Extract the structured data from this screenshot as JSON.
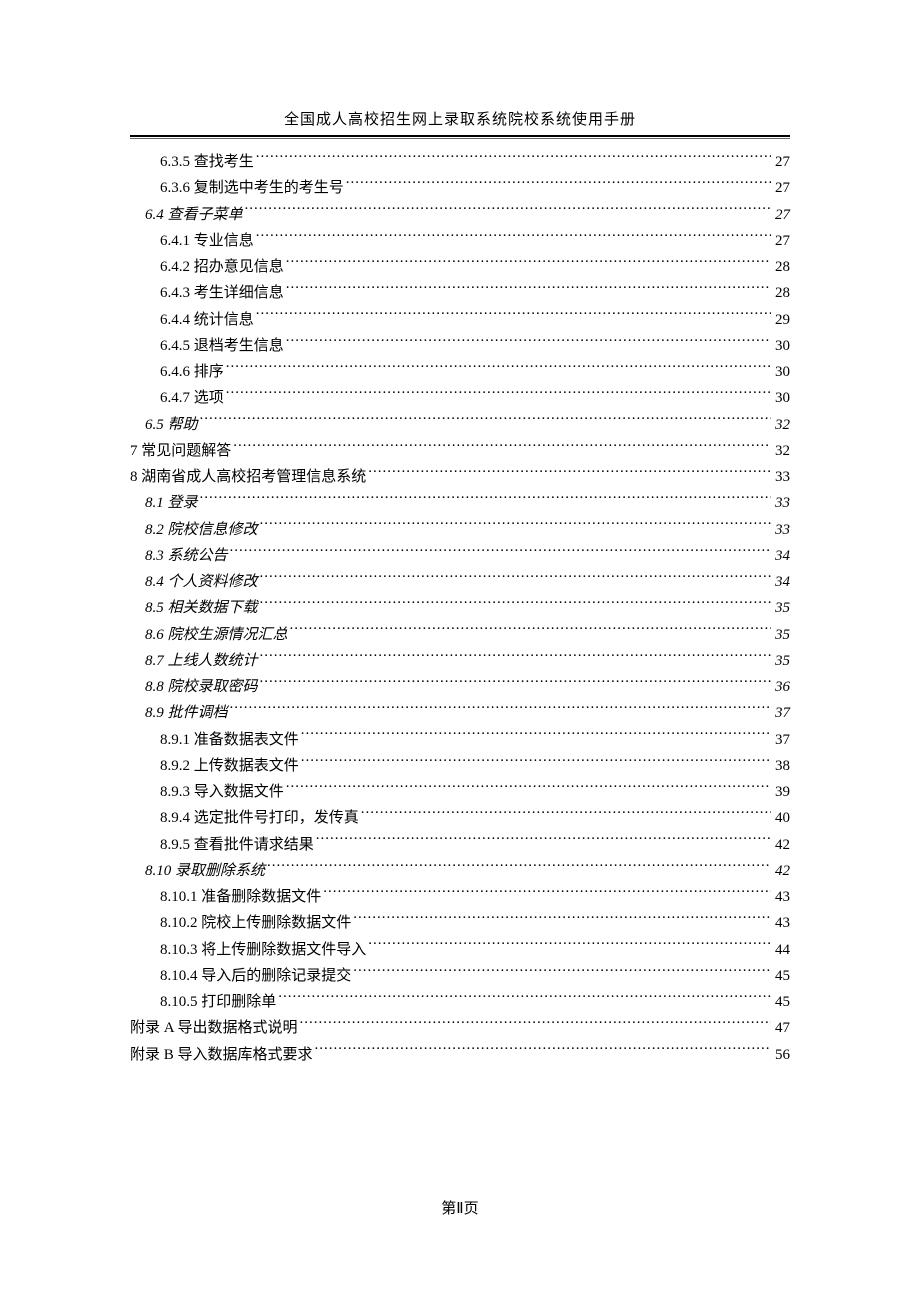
{
  "header": {
    "title": "全国成人高校招生网上录取系统院校系统使用手册"
  },
  "toc": [
    {
      "level": 2,
      "label": "6.3.5 查找考生",
      "page": "27"
    },
    {
      "level": 2,
      "label": "6.3.6 复制选中考生的考生号",
      "page": "27"
    },
    {
      "level": 1,
      "label": "6.4 查看子菜单",
      "page": "27"
    },
    {
      "level": 2,
      "label": "6.4.1 专业信息",
      "page": "27"
    },
    {
      "level": 2,
      "label": "6.4.2 招办意见信息",
      "page": "28"
    },
    {
      "level": 2,
      "label": "6.4.3 考生详细信息",
      "page": "28"
    },
    {
      "level": 2,
      "label": "6.4.4 统计信息",
      "page": "29"
    },
    {
      "level": 2,
      "label": "6.4.5 退档考生信息",
      "page": "30"
    },
    {
      "level": 2,
      "label": "6.4.6 排序",
      "page": "30"
    },
    {
      "level": 2,
      "label": "6.4.7 选项",
      "page": "30"
    },
    {
      "level": 1,
      "label": "6.5 帮助",
      "page": "32"
    },
    {
      "level": 0,
      "label": "7  常见问题解答",
      "page": "32"
    },
    {
      "level": 0,
      "label": "8 湖南省成人高校招考管理信息系统",
      "page": "33"
    },
    {
      "level": 1,
      "label": "8.1 登录",
      "page": "33"
    },
    {
      "level": 1,
      "label": "8.2 院校信息修改",
      "page": "33"
    },
    {
      "level": 1,
      "label": "8.3 系统公告",
      "page": "34"
    },
    {
      "level": 1,
      "label": "8.4 个人资料修改",
      "page": "34"
    },
    {
      "level": 1,
      "label": "8.5 相关数据下载",
      "page": "35"
    },
    {
      "level": 1,
      "label": "8.6 院校生源情况汇总",
      "page": "35"
    },
    {
      "level": 1,
      "label": "8.7 上线人数统计",
      "page": "35"
    },
    {
      "level": 1,
      "label": "8.8 院校录取密码",
      "page": "36"
    },
    {
      "level": 1,
      "label": "8.9 批件调档",
      "page": "37"
    },
    {
      "level": 2,
      "label": "8.9.1 准备数据表文件",
      "page": "37"
    },
    {
      "level": 2,
      "label": "8.9.2 上传数据表文件",
      "page": "38"
    },
    {
      "level": 2,
      "label": "8.9.3 导入数据文件",
      "page": "39"
    },
    {
      "level": 2,
      "label": "8.9.4 选定批件号打印，发传真",
      "page": "40"
    },
    {
      "level": 2,
      "label": "8.9.5 查看批件请求结果",
      "page": "42"
    },
    {
      "level": 1,
      "label": "8.10 录取删除系统",
      "page": "42"
    },
    {
      "level": 2,
      "label": "8.10.1 准备删除数据文件",
      "page": "43"
    },
    {
      "level": 2,
      "label": "8.10.2 院校上传删除数据文件",
      "page": "43"
    },
    {
      "level": 2,
      "label": "8.10.3 将上传删除数据文件导入",
      "page": "44"
    },
    {
      "level": 2,
      "label": "8.10.4 导入后的删除记录提交",
      "page": "45"
    },
    {
      "level": 2,
      "label": "8.10.5 打印删除单",
      "page": "45"
    },
    {
      "level": 0,
      "label": "附录 A   导出数据格式说明",
      "page": "47"
    },
    {
      "level": 0,
      "label": "附录 B   导入数据库格式要求",
      "page": "56"
    }
  ],
  "footer": {
    "page_label": "第Ⅱ页"
  }
}
